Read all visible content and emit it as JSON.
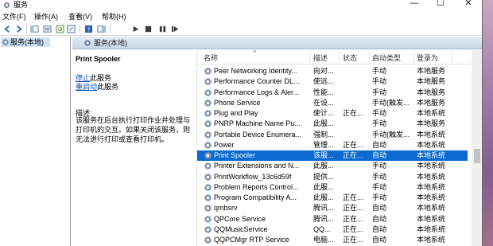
{
  "window": {
    "title": "服务"
  },
  "controls": {
    "minimize": "—",
    "maximize": "☐",
    "close": "✕"
  },
  "menu": [
    "文件(F)",
    "操作(A)",
    "查看(V)",
    "帮助(H)"
  ],
  "toolbar_icons": [
    "back-icon",
    "forward-icon",
    "show-hide-tree-icon",
    "properties-icon",
    "refresh-icon",
    "export-icon",
    "help-icon",
    "show-pane-icon",
    "start-service-icon",
    "stop-service-icon",
    "pause-service-icon",
    "restart-service-icon"
  ],
  "tree": {
    "root_label": "服务(本地)"
  },
  "header": {
    "title": "服务(本地)"
  },
  "detail": {
    "service_name": "Print Spooler",
    "stop_link": "停止",
    "stop_suffix": "此服务",
    "restart_link": "重启动",
    "restart_suffix": "此服务",
    "desc_label": "描述:",
    "desc_text": "该服务在后台执行打印作业并处理与打印机的交互。如果关闭该服务，则无法进行打印或查看打印机。"
  },
  "columns": {
    "name": "名称",
    "description": "描述",
    "status": "状态",
    "startup": "启动类型",
    "logon": "登录为"
  },
  "services": [
    {
      "name": "Peer Networking Identity...",
      "desc": "向对...",
      "status": "",
      "startup": "手动",
      "logon": "本地服务"
    },
    {
      "name": "Performance Counter DL...",
      "desc": "使远...",
      "status": "",
      "startup": "手动",
      "logon": "本地服务"
    },
    {
      "name": "Performance Logs & Aler...",
      "desc": "性能...",
      "status": "",
      "startup": "手动",
      "logon": "本地服务"
    },
    {
      "name": "Phone Service",
      "desc": "在设...",
      "status": "",
      "startup": "手动(触发...",
      "logon": "本地服务"
    },
    {
      "name": "Plug and Play",
      "desc": "使计...",
      "status": "正在...",
      "startup": "手动",
      "logon": "本地系统"
    },
    {
      "name": "PNRP Machine Name Pu...",
      "desc": "此服...",
      "status": "",
      "startup": "手动",
      "logon": "本地服务"
    },
    {
      "name": "Portable Device Enumera...",
      "desc": "强制...",
      "status": "",
      "startup": "手动(触发...",
      "logon": "本地系统"
    },
    {
      "name": "Power",
      "desc": "管理...",
      "status": "正在...",
      "startup": "自动",
      "logon": "本地系统"
    },
    {
      "name": "Print Spooler",
      "desc": "该服...",
      "status": "正在...",
      "startup": "自动",
      "logon": "本地系统"
    },
    {
      "name": "Printer Extensions and N...",
      "desc": "此服...",
      "status": "",
      "startup": "手动",
      "logon": "本地系统"
    },
    {
      "name": "PrintWorkflow_13c6d59f",
      "desc": "提供...",
      "status": "",
      "startup": "手动",
      "logon": "本地系统"
    },
    {
      "name": "Problem Reports Control...",
      "desc": "此服...",
      "status": "",
      "startup": "手动",
      "logon": "本地系统"
    },
    {
      "name": "Program Compatibility A...",
      "desc": "此服...",
      "status": "正在...",
      "startup": "手动",
      "logon": "本地系统"
    },
    {
      "name": "qmbsrv",
      "desc": "腾讯...",
      "status": "正在...",
      "startup": "自动",
      "logon": "本地系统"
    },
    {
      "name": "QPCore Service",
      "desc": "腾讯...",
      "status": "正在...",
      "startup": "自动",
      "logon": "本地系统"
    },
    {
      "name": "QQMusicService",
      "desc": "QQ...",
      "status": "正在...",
      "startup": "自动",
      "logon": "本地系统"
    },
    {
      "name": "QQPCMgr RTP Service",
      "desc": "电脑...",
      "status": "正在...",
      "startup": "自动",
      "logon": "本地系统"
    }
  ],
  "selected_row": "Print Spooler",
  "colors": {
    "selection": "#0a6ad1",
    "link": "#0b4fb3",
    "tree_selection": "#cde3f7"
  }
}
